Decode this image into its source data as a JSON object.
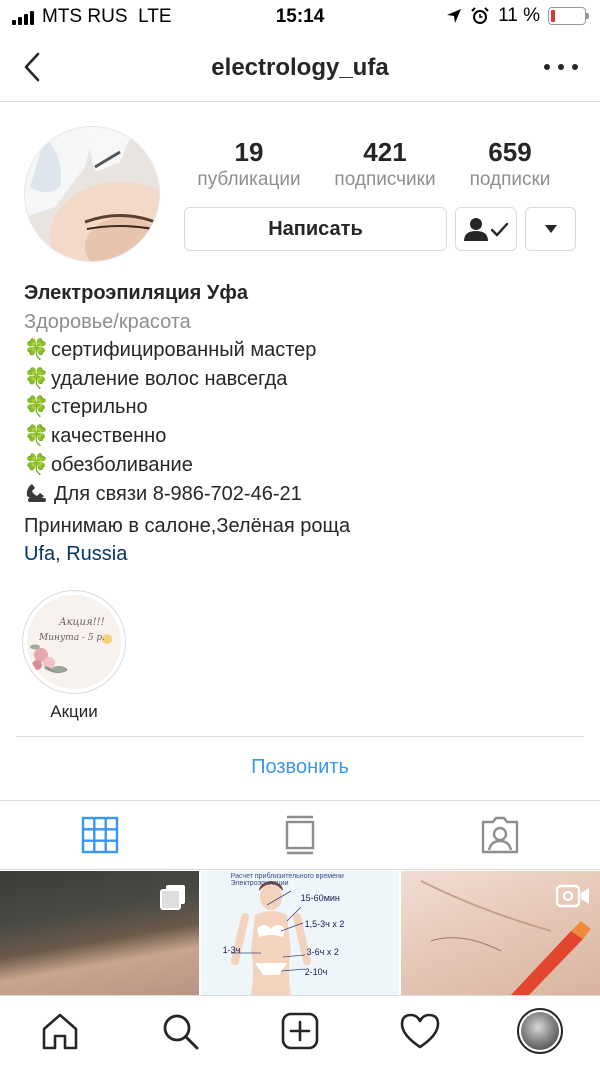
{
  "status_bar": {
    "carrier": "MTS RUS",
    "network": "LTE",
    "time": "15:14",
    "battery_percent": "11 %",
    "battery_level": 0.11,
    "battery_color": "#e5362c"
  },
  "header": {
    "username": "electrology_ufa",
    "back_icon": "chevron-left-icon",
    "more_icon": "ellipsis-icon"
  },
  "profile": {
    "stats": [
      {
        "value": "19",
        "label": "публикации"
      },
      {
        "value": "421",
        "label": "подписчики"
      },
      {
        "value": "659",
        "label": "подписки"
      }
    ],
    "message_button": "Написать",
    "following_icon": "person-check-icon",
    "dropdown_icon": "triangle-down-icon"
  },
  "bio": {
    "name": "Электроэпиляция Уфа",
    "category": "Здоровье/красота",
    "clover_icon": "🍀",
    "lines": [
      "сертифицированный мастер",
      "удаление волос навсегда",
      "стерильно",
      "качественно",
      "обезболивание"
    ],
    "phone_icon": "phone-icon",
    "contact": "Для связи 8-986-702-46-21",
    "address": "Принимаю в салоне,Зелёная роща",
    "location": "Ufa, Russia"
  },
  "highlights": [
    {
      "label": "Акции",
      "cover_line1": "Акция!!!",
      "cover_line2": "Минута - 5 р."
    }
  ],
  "call_button": "Позвонить",
  "tabs": [
    {
      "icon": "grid-icon",
      "active": true
    },
    {
      "icon": "feed-icon",
      "active": false
    },
    {
      "icon": "tagged-icon",
      "active": false
    }
  ],
  "grid_posts": [
    {
      "type": "carousel"
    },
    {
      "type": "image",
      "title": "Расчет приблизительного времени Электроэпиляции",
      "labels": [
        "15-60мин",
        "1,5-3ч х 2",
        "1-3ч",
        "3-6ч х 2",
        "2-10ч"
      ]
    },
    {
      "type": "video"
    }
  ],
  "bottom_nav": [
    {
      "icon": "home-icon"
    },
    {
      "icon": "search-icon"
    },
    {
      "icon": "new-post-icon"
    },
    {
      "icon": "heart-icon"
    },
    {
      "icon": "profile-avatar"
    }
  ],
  "colors": {
    "link_blue": "#3897f0",
    "location_blue": "#003569",
    "text": "#262626",
    "muted": "#8e8e8e",
    "divider": "#dbdbdb"
  }
}
